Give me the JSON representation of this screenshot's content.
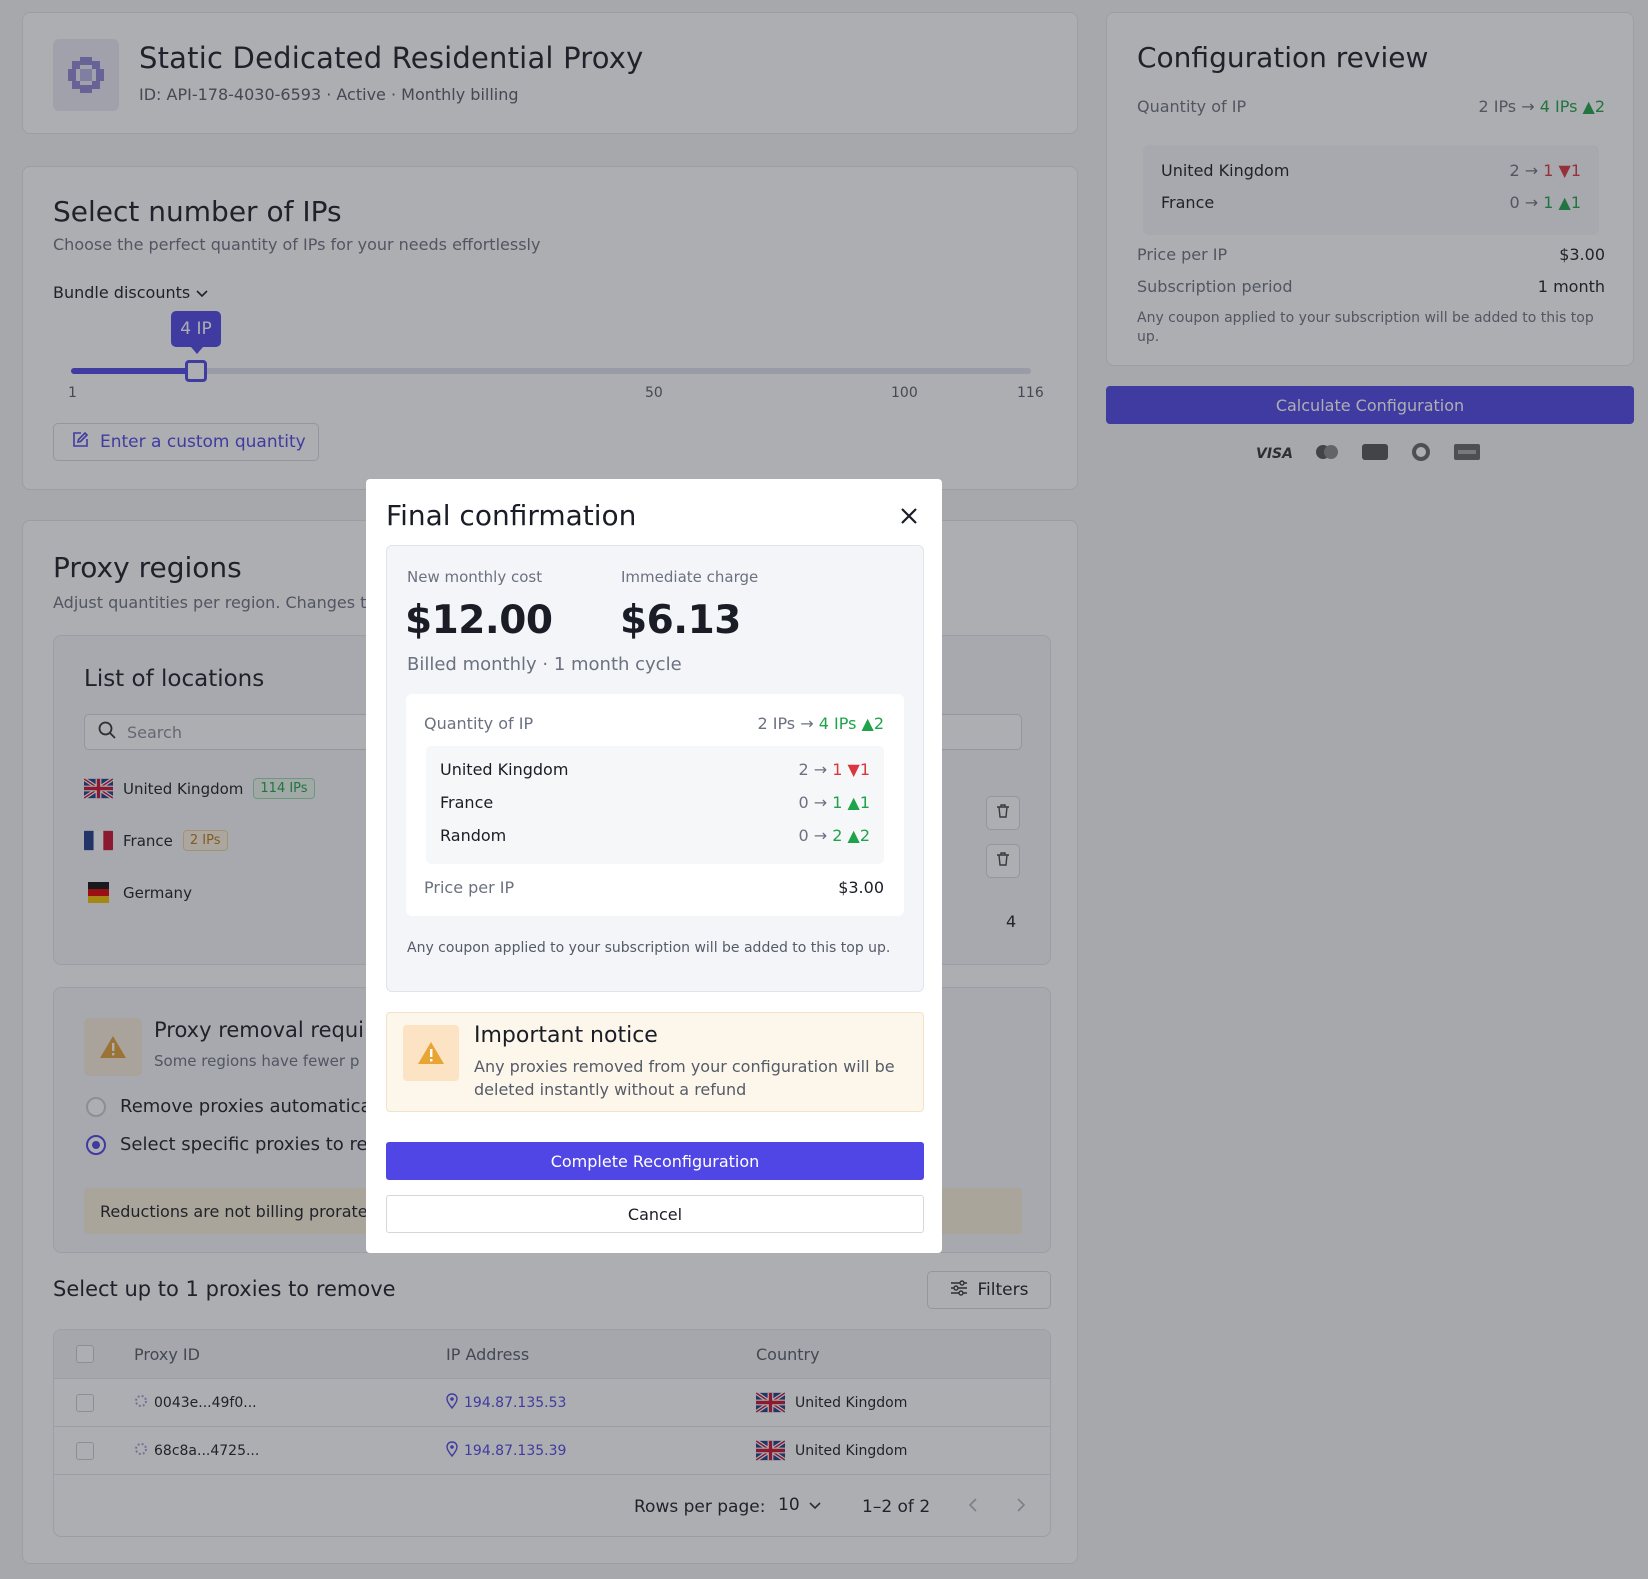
{
  "header": {
    "title": "Static Dedicated Residential Proxy",
    "subtitle": "ID: API-178-4030-6593 · Active · Monthly billing"
  },
  "select_ips": {
    "title": "Select number of IPs",
    "description": "Choose the perfect quantity of IPs for your needs effortlessly",
    "bundle_label": "Bundle discounts",
    "slider_value_label": "4 IP",
    "slider_value": 4,
    "slider_min": 1,
    "slider_max": 116,
    "ticks": [
      "1",
      "50",
      "100",
      "116"
    ],
    "custom_button": "Enter a custom quantity"
  },
  "regions": {
    "title": "Proxy regions",
    "description": "Adjust quantities per region. Changes ta",
    "list_title": "List of locations",
    "search_placeholder": "Search",
    "locations": [
      {
        "name": "United Kingdom",
        "badge": "114 IPs"
      },
      {
        "name": "France",
        "badge": "2 IPs"
      },
      {
        "name": "Germany",
        "badge": ""
      }
    ],
    "total_value": "4"
  },
  "removal": {
    "title": "Proxy removal requi",
    "subtitle": "Some regions have fewer p",
    "option_auto": "Remove proxies automatica",
    "option_specific": "Select specific proxies to re",
    "note": "Reductions are not billing prorated"
  },
  "proxy_table": {
    "title": "Select up to 1 proxies to remove",
    "filters_label": "Filters",
    "columns": [
      "Proxy ID",
      "IP Address",
      "Country"
    ],
    "rows": [
      {
        "id": "0043e...49f0...",
        "ip": "194.87.135.53",
        "country": "United Kingdom"
      },
      {
        "id": "68c8a...4725...",
        "ip": "194.87.135.39",
        "country": "United Kingdom"
      }
    ],
    "rows_per_page_label": "Rows per page:",
    "rows_per_page": "10",
    "range": "1–2 of 2"
  },
  "review": {
    "title": "Configuration review",
    "quantity_label": "Quantity of IP",
    "quantity_from": "2 IPs",
    "quantity_to": "4 IPs",
    "quantity_delta": "▲2",
    "regions": [
      {
        "name": "United Kingdom",
        "from": "2",
        "to": "1",
        "delta": "▼1",
        "dir": "down"
      },
      {
        "name": "France",
        "from": "0",
        "to": "1",
        "delta": "▲1",
        "dir": "up"
      }
    ],
    "price_label": "Price per IP",
    "price_value": "$3.00",
    "period_label": "Subscription period",
    "period_value": "1 month",
    "coupon_note": "Any coupon applied to your subscription will be added to this top up.",
    "calc_button": "Calculate Configuration",
    "payment_icons": [
      "visa-icon",
      "mastercard-icon",
      "jcb-icon",
      "diners-icon",
      "amex-icon"
    ],
    "visa_text": "VISA"
  },
  "modal": {
    "title": "Final confirmation",
    "monthly_label": "New monthly cost",
    "monthly_value": "$12.00",
    "immediate_label": "Immediate charge",
    "immediate_value": "$6.13",
    "billed": "Billed monthly · 1 month cycle",
    "quantity_label": "Quantity of IP",
    "quantity_from": "2 IPs",
    "quantity_to": "4 IPs",
    "quantity_delta": "▲2",
    "regions": [
      {
        "name": "United Kingdom",
        "from": "2",
        "to": "1",
        "delta": "▼1",
        "dir": "down"
      },
      {
        "name": "France",
        "from": "0",
        "to": "1",
        "delta": "▲1",
        "dir": "up"
      },
      {
        "name": "Random",
        "from": "0",
        "to": "2",
        "delta": "▲2",
        "dir": "up"
      }
    ],
    "price_label": "Price per IP",
    "price_value": "$3.00",
    "coupon_note": "Any coupon applied to your subscription will be added to this top up.",
    "notice_title": "Important notice",
    "notice_text": "Any proxies removed from your configuration will be deleted instantly without a refund",
    "confirm_button": "Complete Reconfiguration",
    "cancel_button": "Cancel"
  },
  "colors": {
    "accent": "#4f46e5",
    "up": "#1fa34a",
    "down": "#d9363e",
    "warning_bg": "#fdf6ea"
  }
}
